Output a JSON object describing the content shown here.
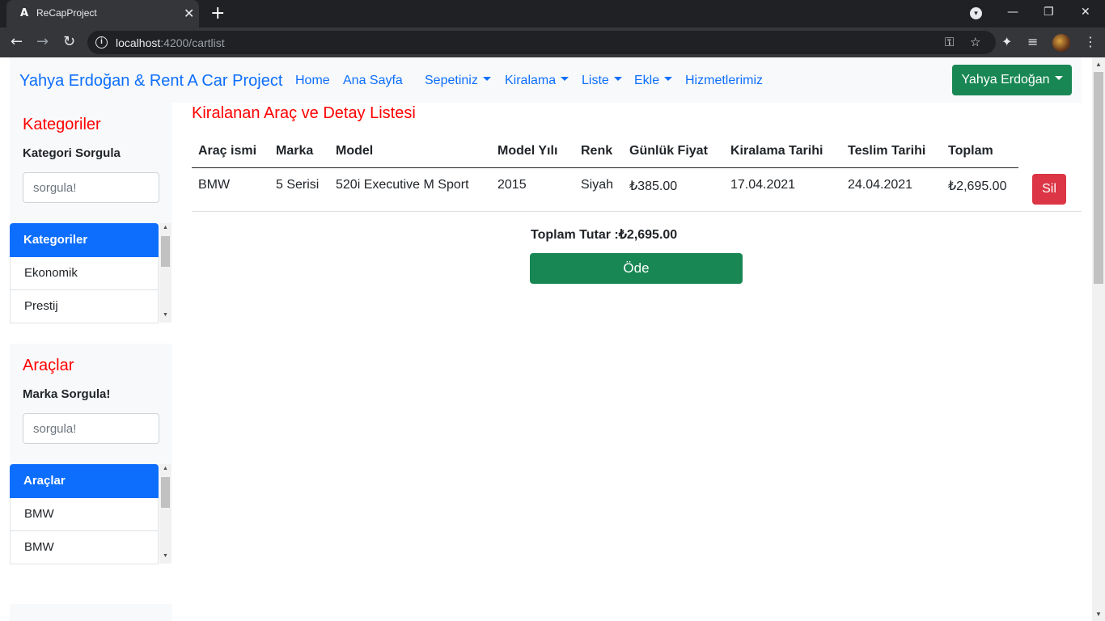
{
  "browser": {
    "tab_title": "ReCapProject",
    "tab_favicon": "A",
    "url_host": "localhost",
    "url_path": ":4200/cartlist"
  },
  "icons": {
    "angular-favicon": "A",
    "close": "✕",
    "plus": "+",
    "minimize": "—",
    "restore": "❐",
    "window-close": "✕",
    "profile-dropdown": "▾",
    "back": "←",
    "forward": "→",
    "reload": "↻",
    "info": "i",
    "key": "⚿",
    "star": "☆",
    "puzzle": "✦",
    "media": "≡",
    "menu": "⋮"
  },
  "navbar": {
    "brand": "Yahya Erdoğan & Rent A Car Project",
    "links": {
      "home": "Home",
      "ana_sayfa": "Ana Sayfa",
      "sepetiniz": "Sepetiniz",
      "kiralama": "Kiralama",
      "liste": "Liste",
      "ekle": "Ekle",
      "hizmetlerimiz": "Hizmetlerimiz"
    },
    "user_button": "Yahya Erdoğan"
  },
  "sidebar": {
    "categories": {
      "title": "Kategoriler",
      "search_label": "Kategori Sorgula",
      "search_placeholder": "sorgula!",
      "list_header": "Kategoriler",
      "items": [
        "Ekonomik",
        "Prestij"
      ]
    },
    "cars": {
      "title": "Araçlar",
      "search_label": "Marka Sorgula!",
      "search_placeholder": "sorgula!",
      "list_header": "Araçlar",
      "items": [
        "BMW",
        "BMW"
      ]
    }
  },
  "main": {
    "title": "Kiralanan Araç ve Detay Listesi",
    "columns": [
      "Araç ismi",
      "Marka",
      "Model",
      "Model Yılı",
      "Renk",
      "Günlük Fiyat",
      "Kiralama Tarihi",
      "Teslim Tarihi",
      "Toplam"
    ],
    "rows": [
      [
        "BMW",
        "5 Serisi",
        "520i Executive M Sport",
        "2015",
        "Siyah",
        "₺385.00",
        "17.04.2021",
        "24.04.2021",
        "₺2,695.00"
      ]
    ],
    "delete_label": "Sil",
    "total_label": "Toplam Tutar :",
    "total_value": "₺2,695.00",
    "pay_label": "Öde"
  },
  "colors": {
    "primary": "#0d6efd",
    "success": "#198754",
    "danger": "#dc3545",
    "heading_red": "#ff0000"
  }
}
